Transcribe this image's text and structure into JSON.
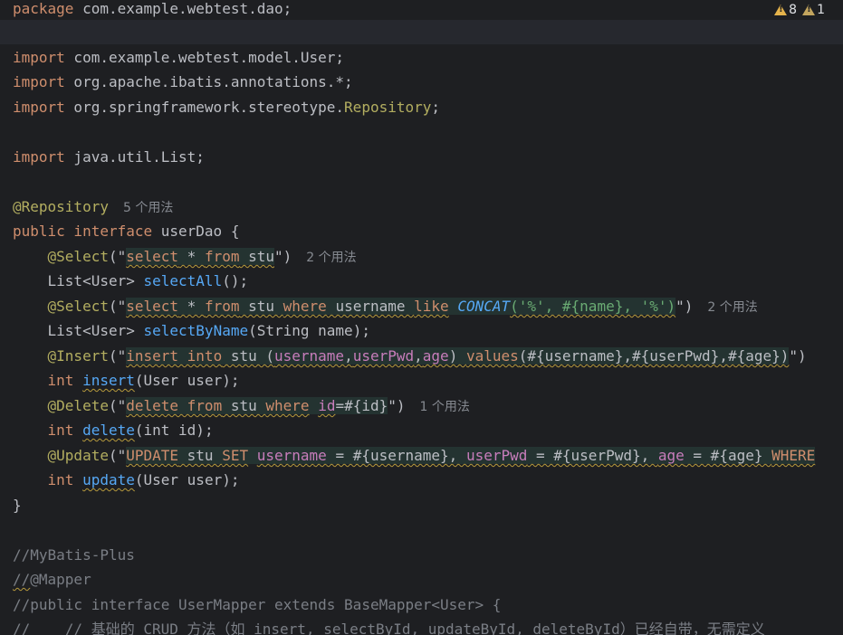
{
  "inspections": {
    "warnings": "8",
    "weak_warnings": "1"
  },
  "code": {
    "l1_kw": "package",
    "l1_rest": " com.example.webtest.dao;",
    "import_kw": "import",
    "l3_rest": " com.example.webtest.model.User;",
    "l4_rest": " org.apache.ibatis.annotations.*;",
    "l5_pre": " org.springframework.stereotype.",
    "l5_cls": "Repository",
    "l5_semi": ";",
    "l7_rest": " java.util.List;",
    "l9_ann": "@Repository",
    "l9_hint": "5 个用法",
    "l10_kw": "public interface",
    "l10_rest": " userDao {",
    "select_ann": "@Select",
    "insert_ann": "@Insert",
    "delete_ann": "@Delete",
    "update_ann": "@Update",
    "open_q": "(\"",
    "close_q": "\")",
    "close_q_update": "",
    "l11_sql_kw1": "select",
    "l11_star": " * ",
    "l11_sql_kw2": "from",
    "l11_tbl": " stu",
    "l11_hint": "2 个用法",
    "l12_type": "    List<User> ",
    "l12_fn": "selectAll",
    "l12_end": "();",
    "l13_sql_kw1": "select",
    "l13_star": " * ",
    "l13_sql_kw2": "from",
    "l13_tbl": " stu ",
    "l13_where": "where",
    "l13_col": " username ",
    "l13_like": "like",
    "l13_sp": " ",
    "l13_concat": "CONCAT",
    "l13_args1": "('%', #{name}, '%')",
    "l13_hint": "2 个用法",
    "l14_type": "    List<User> ",
    "l14_fn": "selectByName",
    "l14_end": "(String name);",
    "l15_ins": "insert into",
    "l15_tbl": " stu (",
    "l15_c1": "username",
    "l15_comma1": ",",
    "l15_c2": "userPwd",
    "l15_comma2": ",",
    "l15_c3": "age",
    "l15_close": ") ",
    "l15_values": "values",
    "l15_rest": "(#{username},#{userPwd},#{age})",
    "int_kw": "int",
    "l16_fn": "insert",
    "l16_end": "(User user);",
    "l17_del": "delete from",
    "l17_tbl": " stu ",
    "l17_where": "where",
    "l17_sp": " ",
    "l17_id": "id",
    "l17_rest": "=#{id}",
    "l17_hint": "1 个用法",
    "l18_fn": "delete",
    "l18_end": "(int id);",
    "l19_upd": "UPDATE",
    "l19_tbl": " stu ",
    "l19_set": "SET",
    "l19_sp1": " ",
    "l19_c1": "username",
    "l19_v1": " = #{username}, ",
    "l19_c2": "userPwd",
    "l19_v2": " = #{userPwd}, ",
    "l19_c3": "age",
    "l19_v3": " = #{age} ",
    "l19_where": "WHERE",
    "l20_fn": "update",
    "l20_end": "(User user);",
    "l21": "}",
    "l23": "//MyBatis-Plus",
    "l24_a": "//",
    "l24_b": "@Mapper",
    "l25": "//public interface UserMapper extends BaseMapper<User> {",
    "l26": "//    // 基础的 CRUD 方法（如 insert, selectById, updateById, deleteById）已经自带，无需定义"
  }
}
